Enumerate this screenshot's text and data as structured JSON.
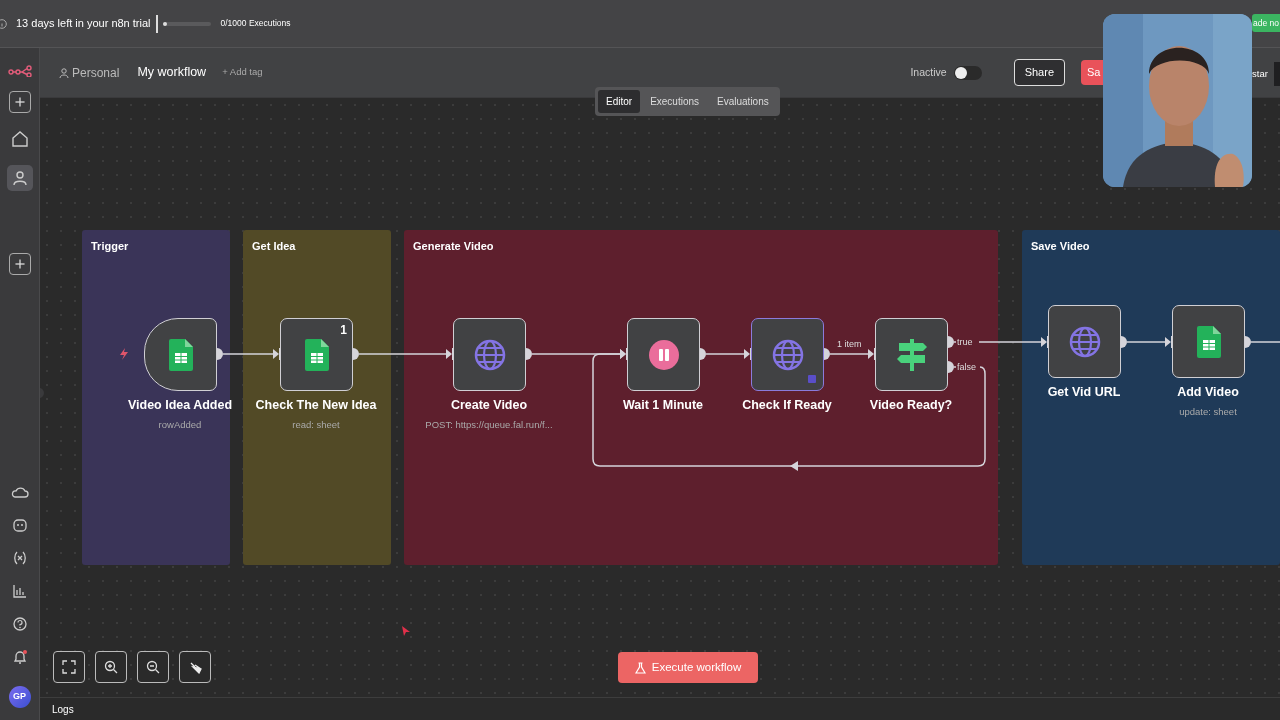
{
  "trial_bar": {
    "text": "13 days left in your n8n trial",
    "level": 0.02,
    "executions": "0/1000 Executions"
  },
  "upgrade_button": {
    "label": "ade no"
  },
  "sidebar": {
    "items": [
      {
        "kind": "add",
        "selected": false
      },
      {
        "kind": "home",
        "selected": false
      },
      {
        "kind": "user",
        "selected": true
      },
      {
        "kind": "add",
        "selected": false
      }
    ],
    "bottom_items": [
      {
        "kind": "cloud",
        "selected": false
      },
      {
        "kind": "bot",
        "selected": false
      },
      {
        "kind": "variables",
        "selected": false
      },
      {
        "kind": "chart",
        "selected": false
      },
      {
        "kind": "help",
        "selected": false
      },
      {
        "kind": "bell",
        "selected": false
      }
    ],
    "avatar": "GP"
  },
  "header": {
    "project": "Personal",
    "title": "My workflow",
    "add_tag": "+ Add tag",
    "status_label": "Inactive",
    "on": false,
    "share": "Share",
    "save": "Sa",
    "star": "star"
  },
  "tabs": [
    {
      "label": "Editor",
      "selected": true
    },
    {
      "label": "Executions",
      "selected": false
    },
    {
      "label": "Evaluations",
      "selected": false
    }
  ],
  "groups": [
    {
      "title": "Trigger",
      "color": "#3a3458"
    },
    {
      "title": "Get Idea",
      "color": "#524a26"
    },
    {
      "title": "Generate Video",
      "color": "#5e1f2d"
    },
    {
      "title": "Save Video",
      "color": "#1f3a58"
    }
  ],
  "nodes": [
    {
      "name": "Video Idea Added",
      "subtitle": "rowAdded",
      "kind": "sheets",
      "trigger": true,
      "selected": false
    },
    {
      "name": "Check The New Idea",
      "subtitle": "read: sheet",
      "kind": "sheets",
      "badge": "1",
      "trigger": false,
      "selected": false
    },
    {
      "name": "Create Video",
      "subtitle": "POST: https://queue.fal.run/f...",
      "kind": "http",
      "trigger": false,
      "selected": false
    },
    {
      "name": "Wait 1 Minute",
      "kind": "wait",
      "trigger": false,
      "selected": false
    },
    {
      "name": "Check If Ready",
      "kind": "http",
      "trigger": false,
      "selected": true
    },
    {
      "name": "Video Ready?",
      "kind": "if",
      "trigger": false,
      "selected": false
    },
    {
      "name": "Get Vid URL",
      "kind": "http",
      "trigger": false,
      "selected": false
    },
    {
      "name": "Add Video",
      "subtitle": "update: sheet",
      "kind": "sheets",
      "trigger": false,
      "selected": false
    }
  ],
  "edge_labels": [
    {
      "label": "1 item"
    },
    {
      "label": "true"
    },
    {
      "label": "false"
    }
  ],
  "execute_button": {
    "label": "Execute workflow"
  },
  "logs": {
    "label": "Logs"
  }
}
